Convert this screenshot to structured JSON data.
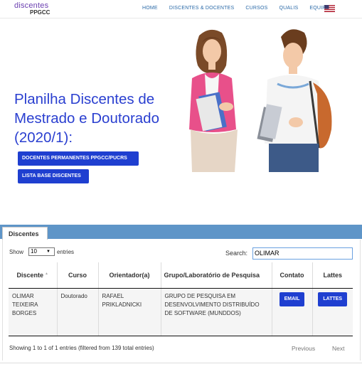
{
  "brand": {
    "logo_top": "discentes",
    "logo_bottom": "PPGCC"
  },
  "nav": {
    "items": [
      "HOME",
      "DISCENTES & DOCENTES",
      "CURSOS",
      "QUALIS",
      "EQUIPE"
    ],
    "flag_icon": "us-flag-icon"
  },
  "hero": {
    "title": "Planilha Discentes de Mestrado e Doutorado (2020/1):",
    "buttons": [
      "DOCENTES PERMANENTES PPGCC/PUCRS",
      "LISTA BASE DISCENTES"
    ]
  },
  "colors": {
    "accent": "#1f3fd0",
    "title": "#2a3fd0",
    "band": "#5e95c8",
    "link": "#2b6aa8"
  },
  "tab": {
    "label": "Discentes"
  },
  "controls": {
    "show_label": "Show",
    "show_value": "10",
    "entries_label": "entries",
    "search_label": "Search:",
    "search_value": "OLIMAR"
  },
  "table": {
    "headers": [
      "Discente",
      "Curso",
      "Orientador(a)",
      "Grupo/Laboratório de Pesquisa",
      "Contato",
      "Lattes"
    ],
    "rows": [
      {
        "discente": "OLIMAR TEIXEIRA BORGES",
        "curso": "Doutorado",
        "orientador": "RAFAEL PRIKLADNICKI",
        "grupo": "GRUPO DE PESQUISA EM DESENVOLVIMENTO DISTRIBUÍDO DE SOFTWARE (MUNDDOS)",
        "contato": "EMAIL",
        "lattes": "LATTES"
      }
    ]
  },
  "footer": {
    "info": "Showing 1 to 1 of 1 entries (filtered from 139 total entries)",
    "previous": "Previous",
    "next": "Next"
  }
}
